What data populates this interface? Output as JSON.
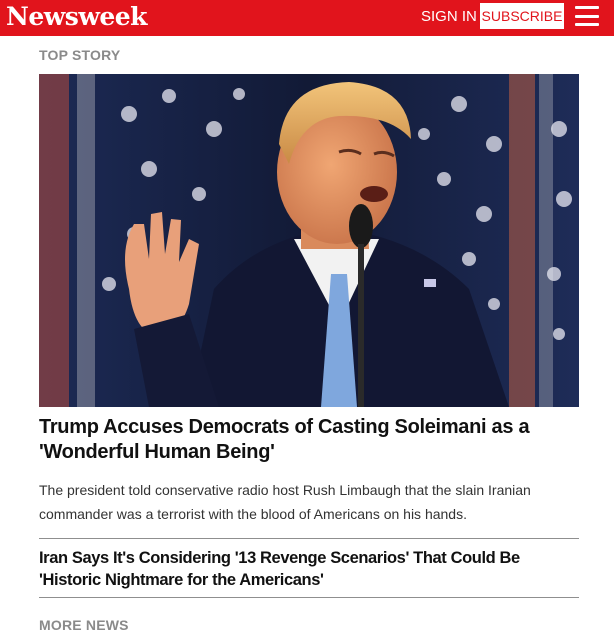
{
  "header": {
    "logo": "Newsweek",
    "sign_in": "SIGN IN",
    "subscribe": "SUBSCRIBE",
    "menu_icon": "hamburger-menu-icon",
    "background_color": "#e1141c"
  },
  "top_story": {
    "label": "TOP STORY",
    "headline": "Trump Accuses Democrats of Casting Soleimani as a 'Wonderful Human Being'",
    "summary": "The president told conservative radio host Rush Limbaugh that the slain Iranian commander was a terrorist with the blood of Americans on his hands."
  },
  "related": {
    "headline": "Iran Says It's Considering '13 Revenge Scenarios' That Could Be 'Historic Nightmare for the Americans'"
  },
  "more_news": {
    "label": "MORE NEWS"
  }
}
